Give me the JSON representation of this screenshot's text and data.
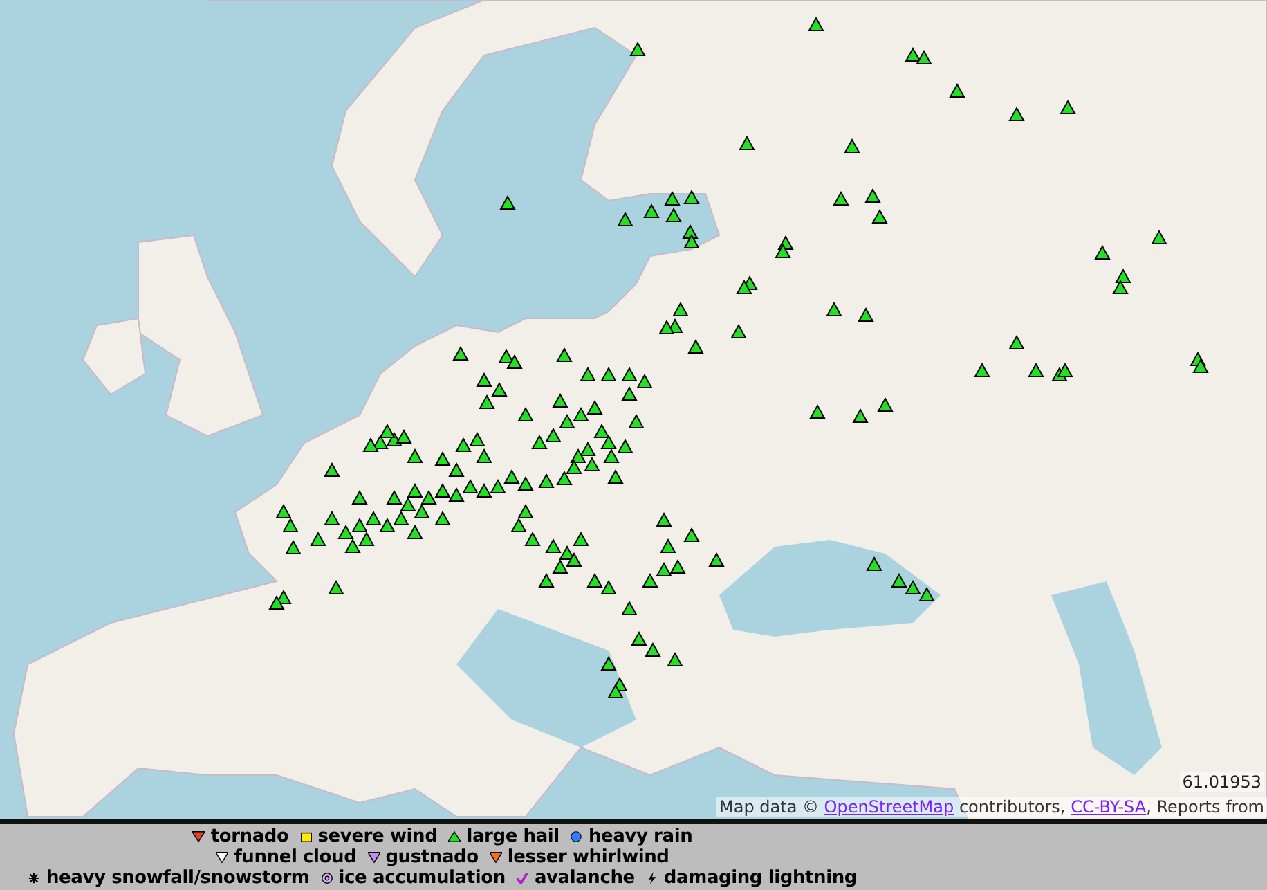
{
  "map": {
    "coordinate_readout": "61.01953",
    "attribution": [
      {
        "kind": "text",
        "text": "Map data © "
      },
      {
        "kind": "link",
        "text": "OpenStreetMap"
      },
      {
        "kind": "text",
        "text": " contributors, "
      },
      {
        "kind": "link",
        "text": "CC-BY-SA"
      },
      {
        "kind": "text",
        "text": ", Reports from"
      }
    ]
  },
  "legend": {
    "rows": [
      [
        {
          "kind": "tornado",
          "label": "tornado"
        },
        {
          "kind": "severe_wind",
          "label": "severe wind"
        },
        {
          "kind": "large_hail",
          "label": "large hail"
        },
        {
          "kind": "heavy_rain",
          "label": "heavy rain"
        }
      ],
      [
        {
          "kind": "funnel_cloud",
          "label": "funnel cloud"
        },
        {
          "kind": "gustnado",
          "label": "gustnado"
        },
        {
          "kind": "lesser_whirlwind",
          "label": "lesser whirlwind"
        }
      ],
      [
        {
          "kind": "snowfall",
          "label": "heavy snowfall/snowstorm"
        },
        {
          "kind": "ice",
          "label": "ice accumulation"
        },
        {
          "kind": "avalanche",
          "label": "avalanche"
        },
        {
          "kind": "lightning",
          "label": "damaging lightning"
        }
      ]
    ]
  }
}
